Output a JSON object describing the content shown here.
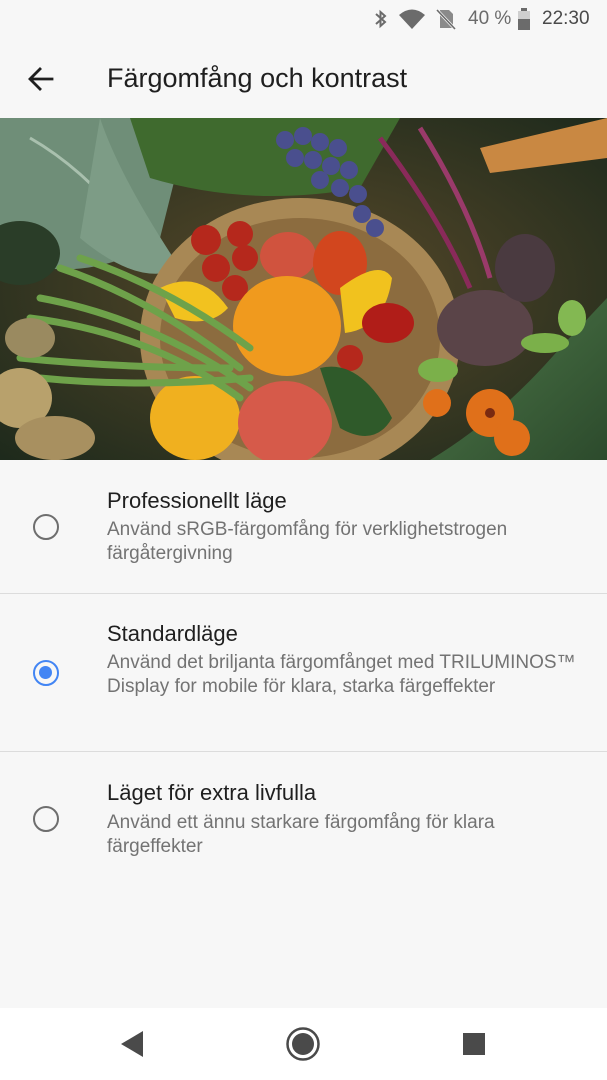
{
  "status_bar": {
    "battery": "40 %",
    "time": "22:30",
    "icons": [
      "bluetooth-icon",
      "wifi-icon",
      "no-sim-icon",
      "battery-icon"
    ]
  },
  "app_bar": {
    "title": "Färgomfång och kontrast",
    "back_icon": "arrow-back-icon"
  },
  "hero": {
    "image": "vegetables-basket-photo"
  },
  "options": [
    {
      "title": "Professionellt läge",
      "subtitle": "Använd sRGB-färgomfång för verklighetstrogen färgåtergivning",
      "selected": false
    },
    {
      "title": "Standardläge",
      "subtitle": "Använd det briljanta färgomfånget med TRILUMINOS™ Display for mobile för klara, starka färgeffekter",
      "selected": true
    },
    {
      "title": "Läget för extra livfulla",
      "subtitle": "Använd ett ännu starkare färgomfång för klara färgeffekter",
      "selected": false
    }
  ],
  "nav_bar": {
    "icons": [
      "back-triangle-icon",
      "home-circle-icon",
      "recents-square-icon"
    ]
  },
  "colors": {
    "accent": "#4285f4",
    "background": "#f7f7f7",
    "divider": "#dcdcdc"
  }
}
